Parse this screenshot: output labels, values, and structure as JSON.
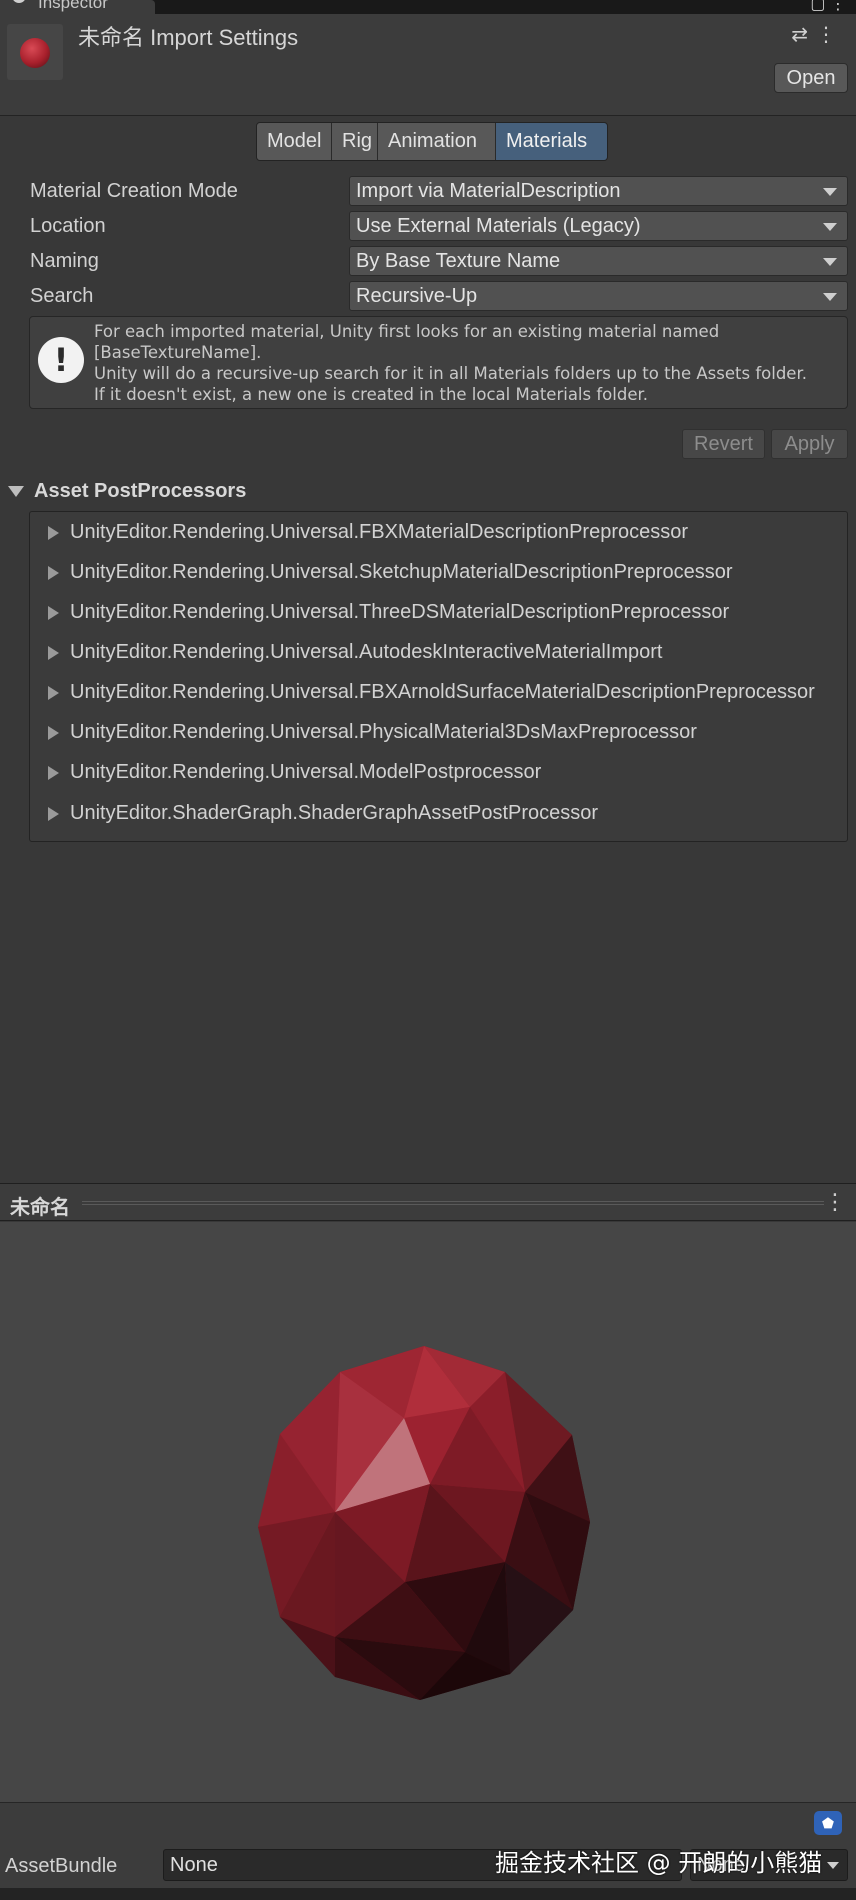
{
  "window": {
    "tab_label": "Inspector",
    "header_title": "未命名 Import Settings",
    "open_label": "Open",
    "settings_icon": "sliders-icon",
    "more_icon": "kebab-icon"
  },
  "tabs": [
    {
      "label": "Model",
      "active": false
    },
    {
      "label": "Rig",
      "active": false
    },
    {
      "label": "Animation",
      "active": false
    },
    {
      "label": "Materials",
      "active": true
    }
  ],
  "properties": [
    {
      "label": "Material Creation Mode",
      "value": "Import via MaterialDescription"
    },
    {
      "label": "Location",
      "value": "Use External Materials (Legacy)"
    },
    {
      "label": "Naming",
      "value": "By Base Texture Name"
    },
    {
      "label": "Search",
      "value": "Recursive-Up"
    }
  ],
  "help": {
    "text": "For each imported material, Unity first looks for an existing material named\n[BaseTextureName].\nUnity will do a recursive-up search for it in all Materials folders up to the Assets folder.\nIf it doesn't exist, a new one is created in the local Materials folder."
  },
  "actions": {
    "revert": "Revert",
    "apply": "Apply"
  },
  "postprocessors": {
    "title": "Asset PostProcessors",
    "items": [
      "UnityEditor.Rendering.Universal.FBXMaterialDescriptionPreprocessor",
      "UnityEditor.Rendering.Universal.SketchupMaterialDescriptionPreprocessor",
      "UnityEditor.Rendering.Universal.ThreeDSMaterialDescriptionPreprocessor",
      "UnityEditor.Rendering.Universal.AutodeskInteractiveMaterialImport",
      "UnityEditor.Rendering.Universal.FBXArnoldSurfaceMaterialDescriptionPreprocessor",
      "UnityEditor.Rendering.Universal.PhysicalMaterial3DsMaxPreprocessor",
      "UnityEditor.Rendering.Universal.ModelPostprocessor",
      "UnityEditor.ShaderGraph.ShaderGraphAssetPostProcessor"
    ]
  },
  "preview": {
    "title": "未命名"
  },
  "assetbundle": {
    "label": "AssetBundle",
    "value": "None",
    "variant": "None"
  },
  "watermark": "掘金技术社区 @ 开朗的小熊猫",
  "colors": {
    "active_tab": "#46607c",
    "sphere": "#a8202c",
    "tag_icon": "#2f63b8"
  }
}
